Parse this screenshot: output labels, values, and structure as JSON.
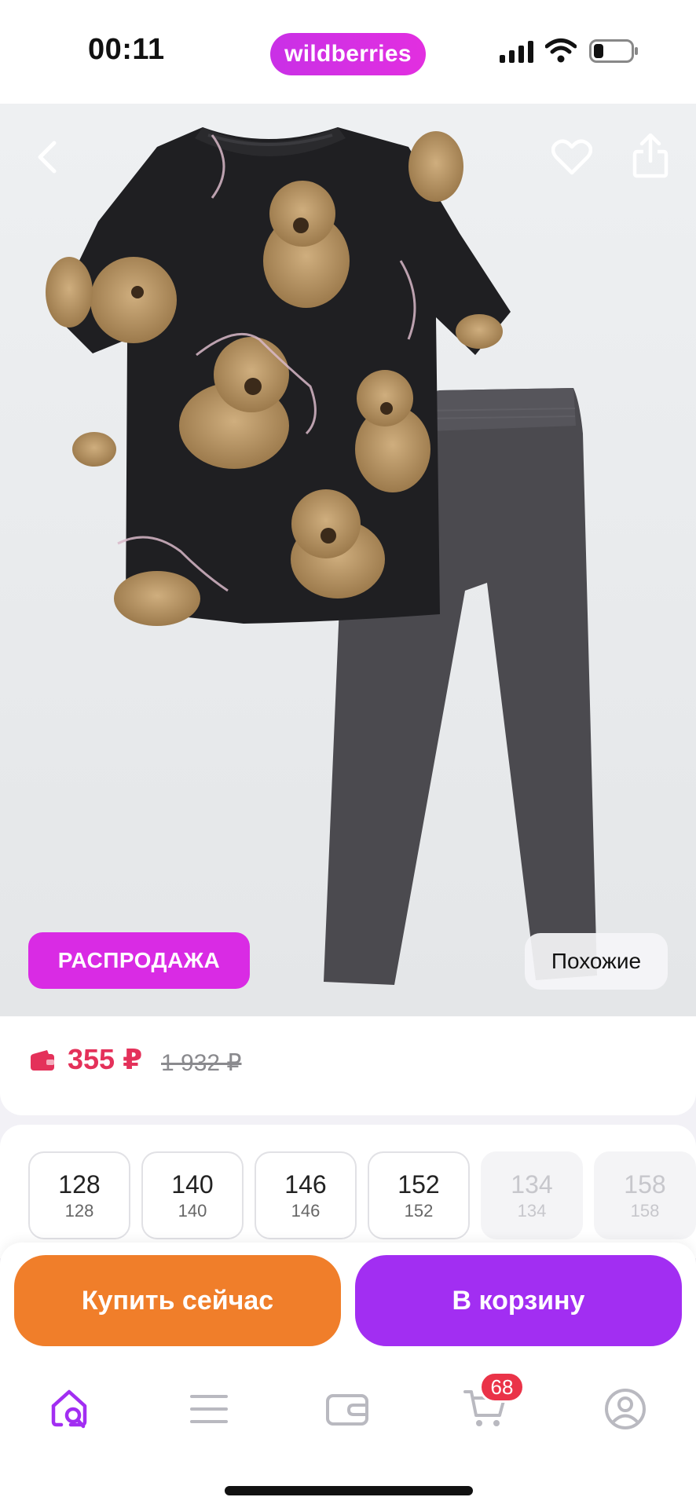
{
  "status_bar": {
    "time": "00:11",
    "brand": "wildberries"
  },
  "product": {
    "sale_badge": "РАСПРОДАЖА",
    "similar_label": "Похожие",
    "price_current": "355 ₽",
    "price_old": "1 932 ₽"
  },
  "sizes": [
    {
      "main": "128",
      "sub": "128",
      "available": true
    },
    {
      "main": "140",
      "sub": "140",
      "available": true
    },
    {
      "main": "146",
      "sub": "146",
      "available": true
    },
    {
      "main": "152",
      "sub": "152",
      "available": true
    },
    {
      "main": "134",
      "sub": "134",
      "available": false
    },
    {
      "main": "158",
      "sub": "158",
      "available": false
    }
  ],
  "actions": {
    "buy_now": "Купить сейчас",
    "to_cart": "В корзину"
  },
  "tabbar": {
    "items": [
      "home-search-icon",
      "menu-icon",
      "wallet-icon",
      "cart-icon",
      "profile-icon"
    ],
    "cart_count": "68"
  },
  "colors": {
    "accent": "#a22ef2",
    "buy": "#f07e2a",
    "sale": "#d92be4",
    "price": "#e4315a"
  }
}
